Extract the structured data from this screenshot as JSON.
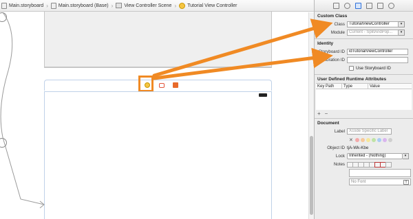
{
  "breadcrumb": [
    {
      "label": "Main.storyboard",
      "icon": "storyboard-icon"
    },
    {
      "label": "Main.storyboard (Base)",
      "icon": "storyboard-icon"
    },
    {
      "label": "View Controller Scene",
      "icon": "scene-icon"
    },
    {
      "label": "Tutorial View Controller",
      "icon": "view-controller-icon"
    }
  ],
  "inspector": {
    "custom_class": {
      "title": "Custom Class",
      "class_label": "Class",
      "class_value": "TutorialViewController",
      "module_label": "Module",
      "module_value": "Current - SplitAndPop..."
    },
    "identity": {
      "title": "Identity",
      "storyboard_id_label": "Storyboard ID",
      "storyboard_id_value": "idTutorialViewController",
      "restoration_id_label": "Restoration ID",
      "restoration_id_value": "",
      "use_storyboard_id_label": "Use Storyboard ID"
    },
    "runtime_attributes": {
      "title": "User Defined Runtime Attributes",
      "columns": [
        "Key Path",
        "Type",
        "Value"
      ],
      "add": "+",
      "remove": "−"
    },
    "document": {
      "title": "Document",
      "label_label": "Label",
      "label_placeholder": "Xcode Specific Label",
      "object_id_label": "Object ID",
      "object_id_value": "tjA-Wk-Kbe",
      "lock_label": "Lock",
      "lock_value": "Inherited - (Nothing)",
      "notes_label": "Notes",
      "font_placeholder": "No Font"
    }
  },
  "colors": {
    "highlight": "#f08a24",
    "arrow": "#f08a24",
    "swatches": [
      "#e8e8e8",
      "#f4a9a9",
      "#f7c99a",
      "#f6e79a",
      "#bfe3a6",
      "#a9cdf4",
      "#d9b5ef",
      "#cfcfcf"
    ]
  }
}
